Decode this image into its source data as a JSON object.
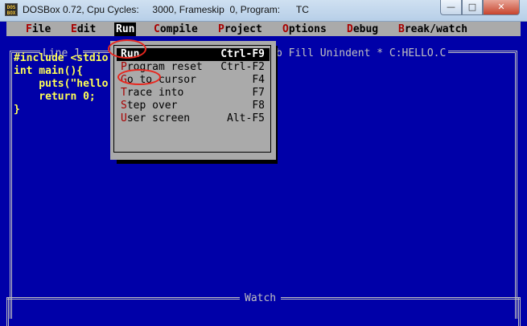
{
  "window": {
    "icon_text": "DOS BOX",
    "title": "DOSBox 0.72, Cpu Cycles:     3000, Frameskip  0, Program:      TC",
    "min_glyph": "—",
    "max_glyph": "□",
    "close_glyph": "✕"
  },
  "menubar": {
    "items": [
      {
        "hot": "F",
        "rest": "ile"
      },
      {
        "hot": "E",
        "rest": "dit"
      },
      {
        "hot": "R",
        "rest": "un"
      },
      {
        "hot": "C",
        "rest": "ompile"
      },
      {
        "hot": "P",
        "rest": "roject"
      },
      {
        "hot": "O",
        "rest": "ptions"
      },
      {
        "hot": "D",
        "rest": "ebug"
      },
      {
        "hot": "B",
        "rest": "reak/watch"
      }
    ]
  },
  "editor": {
    "status_left": "Line 1",
    "status_right": "b Fill Unindent * C:HELLO.C",
    "lines": [
      "#include <stdio",
      "int main(){",
      "    puts(\"hello",
      "    return 0;",
      "}"
    ]
  },
  "run_menu": {
    "items": [
      {
        "hot": "R",
        "rest": "un",
        "shortcut": "Ctrl-F9"
      },
      {
        "hot": "P",
        "rest": "rogram reset",
        "shortcut": "Ctrl-F2"
      },
      {
        "hot": "G",
        "rest": "o to cursor",
        "shortcut": "F4"
      },
      {
        "hot": "T",
        "rest": "race into",
        "shortcut": "F7"
      },
      {
        "hot": "S",
        "rest": "tep over",
        "shortcut": "F8"
      },
      {
        "hot": "U",
        "rest": "ser screen",
        "shortcut": "Alt-F5"
      }
    ],
    "selected_index": 0
  },
  "watch": {
    "title": "Watch"
  },
  "colors": {
    "screen_bg": "#0000a8",
    "menubar_bg": "#aaaaaa",
    "hotkey": "#a80000",
    "code_text": "#ffff55",
    "annotation": "#e8271f"
  }
}
